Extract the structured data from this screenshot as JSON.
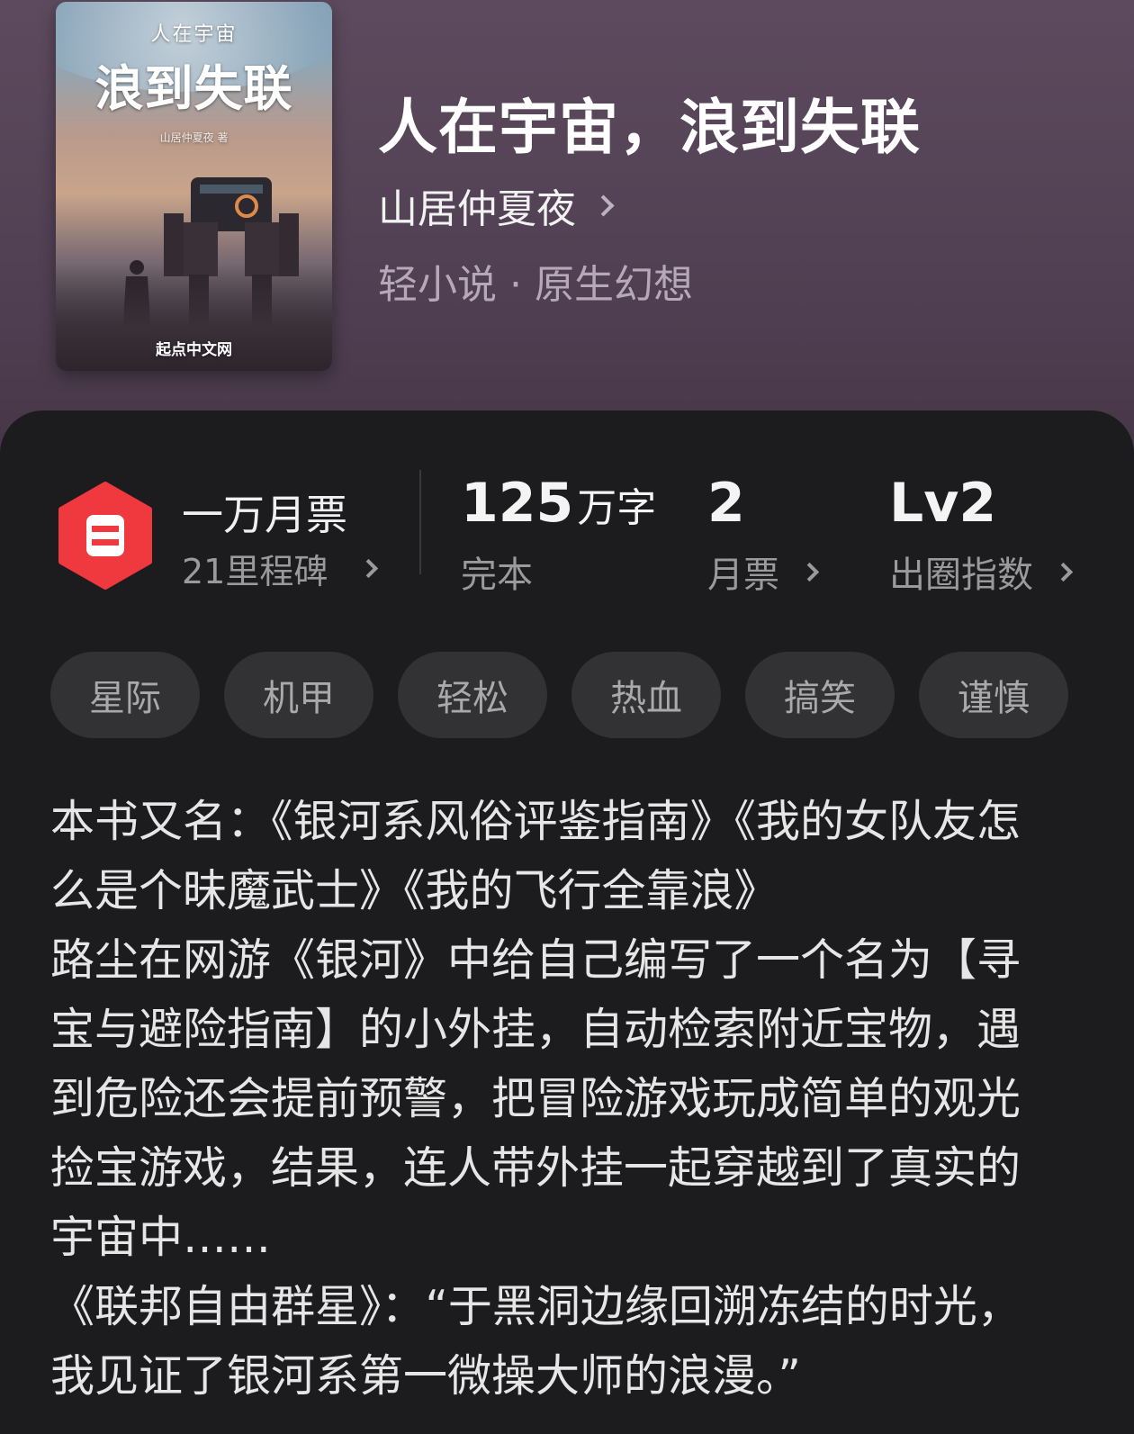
{
  "book": {
    "cover": {
      "top_text": "人在宇宙",
      "main_text": "浪到失联",
      "author_text": "山居仲夏夜 著",
      "publisher": "起点中文网"
    },
    "title": "人在宇宙，浪到失联",
    "author": "山居仲夏夜",
    "category": "轻小说 · 原生幻想"
  },
  "milestone": {
    "title": "一万月票",
    "subtitle": "21里程碑",
    "badge_color": "#f0383f"
  },
  "stats": [
    {
      "value": "125",
      "unit": "万字",
      "label": "完本"
    },
    {
      "value": "2",
      "unit": "",
      "label": "月票"
    },
    {
      "value": "Lv2",
      "unit": "",
      "label": "出圈指数"
    }
  ],
  "tags": [
    "星际",
    "机甲",
    "轻松",
    "热血",
    "搞笑",
    "谨慎"
  ],
  "description": [
    "本书又名：《银河系风俗评鉴指南》《我的女队友怎么是个昧魔武士》《我的飞行全靠浪》",
    "路尘在网游《银河》中给自己编写了一个名为【寻宝与避险指南】的小外挂，自动检索附近宝物，遇到危险还会提前预警，把冒险游戏玩成简单的观光捡宝游戏，结果，连人带外挂一起穿越到了真实的宇宙中……",
    "《联邦自由群星》：“于黑洞边缘回溯冻结的时光，我见证了银河系第一微操大师的浪漫。”"
  ]
}
